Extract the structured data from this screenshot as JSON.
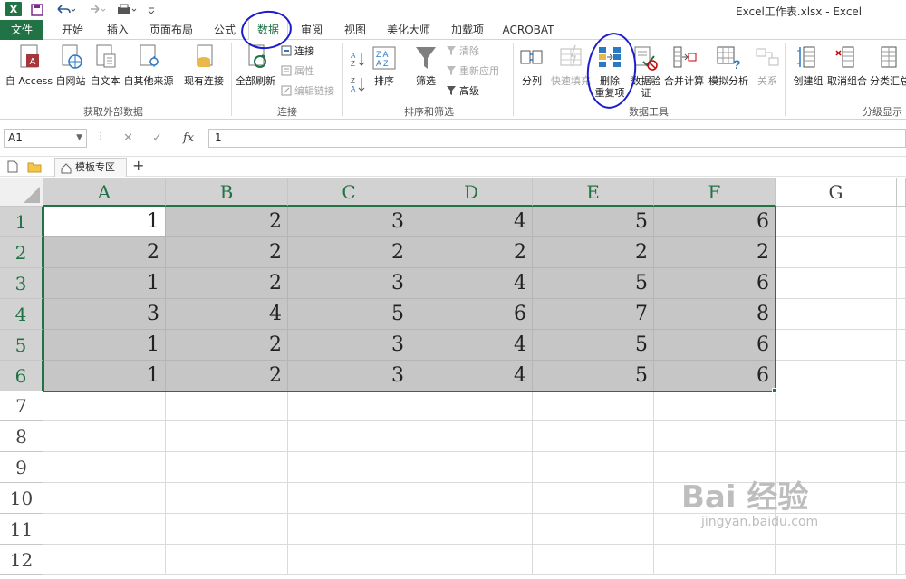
{
  "window": {
    "title": "Excel工作表.xlsx - Excel"
  },
  "tabs": [
    "文件",
    "开始",
    "插入",
    "页面布局",
    "公式",
    "数据",
    "审阅",
    "视图",
    "美化大师",
    "加载项",
    "ACROBAT"
  ],
  "active_tab": "数据",
  "ribbon": {
    "get_external": {
      "label": "获取外部数据",
      "from_access": "自 Access",
      "from_web": "自网站",
      "from_text": "自文本",
      "from_other": "自其他来源",
      "existing": "现有连接"
    },
    "connections": {
      "label": "连接",
      "refresh_all": "全部刷新",
      "connections": "连接",
      "properties": "属性",
      "edit_links": "编辑链接"
    },
    "sort_filter": {
      "label": "排序和筛选",
      "sort": "排序",
      "filter": "筛选",
      "clear": "清除",
      "reapply": "重新应用",
      "advanced": "高级"
    },
    "data_tools": {
      "label": "数据工具",
      "text_to_columns": "分列",
      "flash_fill": "快速填充",
      "remove_dup_1": "删除",
      "remove_dup_2": "重复项",
      "validation_1": "数据验",
      "validation_2": "证",
      "consolidate": "合并计算",
      "what_if": "模拟分析",
      "relationships": "关系"
    },
    "outline": {
      "label": "分级显示",
      "group": "创建组",
      "ungroup": "取消组合",
      "subtotal": "分类汇总"
    }
  },
  "formula_bar": {
    "name_box": "A1",
    "fx": "fx",
    "value": "1"
  },
  "doc_tabs": {
    "template_tab": "模板专区",
    "add": "+"
  },
  "columns": [
    "A",
    "B",
    "C",
    "D",
    "E",
    "F",
    "G"
  ],
  "rows": [
    "1",
    "2",
    "3",
    "4",
    "5",
    "6",
    "7",
    "8",
    "9",
    "10",
    "11",
    "12"
  ],
  "cells": [
    [
      "1",
      "2",
      "3",
      "4",
      "5",
      "6"
    ],
    [
      "2",
      "2",
      "2",
      "2",
      "2",
      "2"
    ],
    [
      "1",
      "2",
      "3",
      "4",
      "5",
      "6"
    ],
    [
      "3",
      "4",
      "5",
      "6",
      "7",
      "8"
    ],
    [
      "1",
      "2",
      "3",
      "4",
      "5",
      "6"
    ],
    [
      "1",
      "2",
      "3",
      "4",
      "5",
      "6"
    ]
  ],
  "watermark": {
    "brand": "Bai 经验",
    "url": "jingyan.baidu.com"
  },
  "colors": {
    "excel_green": "#217346",
    "selection_gray": "#c6c6c6",
    "annotation_blue": "#1c1ccf"
  }
}
